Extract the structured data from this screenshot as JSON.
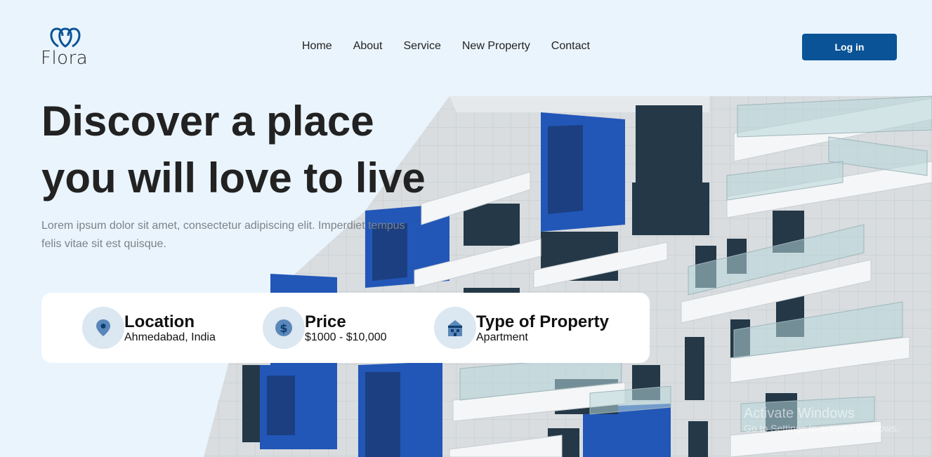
{
  "brand": {
    "name": "Flora",
    "logo_icon": "interlocking-rings-icon",
    "accent": "#0a5396"
  },
  "nav": {
    "items": [
      {
        "label": "Home"
      },
      {
        "label": "About"
      },
      {
        "label": "Service"
      },
      {
        "label": "New Property"
      },
      {
        "label": "Contact"
      }
    ],
    "login_label": "Log in"
  },
  "hero": {
    "title_line1": "Discover a place",
    "title_line2": "you will love to live",
    "subtitle": "Lorem ipsum dolor sit amet, consectetur adipiscing elit. Imperdiet tempus felis vitae sit est quisque."
  },
  "search": {
    "location": {
      "label": "Location",
      "value": "Ahmedabad, India",
      "icon": "map-pin-icon"
    },
    "price": {
      "label": "Price",
      "value": "$1000 - $10,000",
      "icon": "dollar-icon"
    },
    "type": {
      "label": "Type of Property",
      "value": "Apartment",
      "icon": "house-icon"
    }
  },
  "watermark": {
    "line1": "Activate Windows",
    "line2": "Go to Settings to activate Windows."
  }
}
